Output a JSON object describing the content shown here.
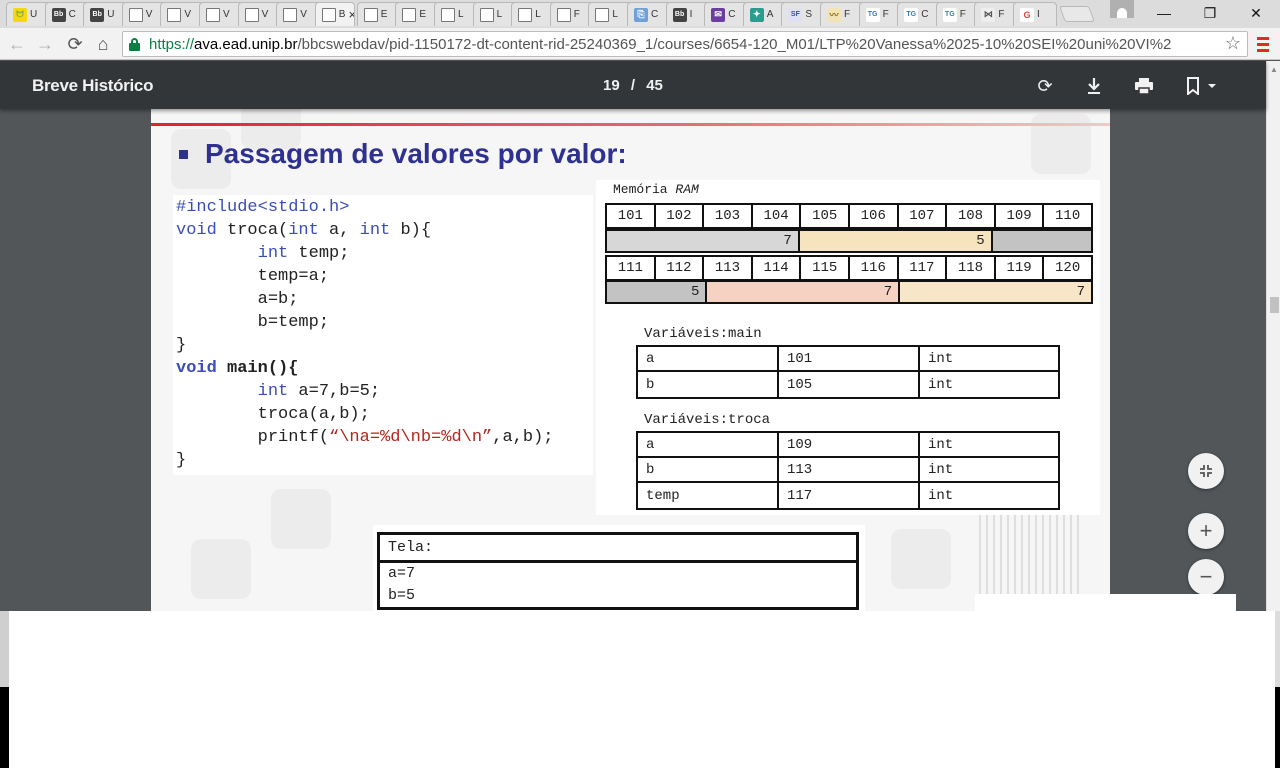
{
  "browser": {
    "tabs": [
      {
        "icon": "moodle-icon",
        "label": "U",
        "active": false
      },
      {
        "icon": "blackboard-icon",
        "label": "C",
        "active": false
      },
      {
        "icon": "blackboard-icon",
        "label": "U",
        "active": false
      },
      {
        "icon": "document-icon",
        "label": "V",
        "active": false
      },
      {
        "icon": "document-icon",
        "label": "V",
        "active": false
      },
      {
        "icon": "document-icon",
        "label": "V",
        "active": false
      },
      {
        "icon": "document-icon",
        "label": "V",
        "active": false
      },
      {
        "icon": "document-icon",
        "label": "V",
        "active": false
      },
      {
        "icon": "document-icon",
        "label": "B",
        "active": true
      },
      {
        "icon": "document-icon",
        "label": "E",
        "active": false
      },
      {
        "icon": "document-icon",
        "label": "E",
        "active": false
      },
      {
        "icon": "document-icon",
        "label": "L",
        "active": false
      },
      {
        "icon": "document-icon",
        "label": "L",
        "active": false
      },
      {
        "icon": "document-icon",
        "label": "L",
        "active": false
      },
      {
        "icon": "document-icon",
        "label": "F",
        "active": false
      },
      {
        "icon": "document-icon",
        "label": "L",
        "active": false
      },
      {
        "icon": "link-icon",
        "label": "C",
        "active": false
      },
      {
        "icon": "blackboard-icon",
        "label": "I",
        "active": false
      },
      {
        "icon": "mail-icon",
        "label": "C",
        "active": false
      },
      {
        "icon": "app-icon",
        "label": "A",
        "active": false
      },
      {
        "icon": "sf-icon",
        "label": "S",
        "active": false
      },
      {
        "icon": "fingerprint-icon",
        "label": "F",
        "active": false
      },
      {
        "icon": "tg-icon",
        "label": "F",
        "active": false
      },
      {
        "icon": "tg-icon",
        "label": "C",
        "active": false
      },
      {
        "icon": "tg-icon",
        "label": "F",
        "active": false
      },
      {
        "icon": "network-icon",
        "label": "F",
        "active": false
      },
      {
        "icon": "google-icon",
        "label": "I",
        "active": false
      }
    ],
    "active_tab_close": "×",
    "url": {
      "scheme": "https://",
      "host": "ava.ead.unip.br",
      "path": "/bbcswebdav/pid-1150172-dt-content-rid-25240369_1/courses/6654-120_M01/LTP%20Vanessa%2025-10%20SEI%20uni%20VI%2"
    }
  },
  "pdf": {
    "title": "Breve Histórico",
    "page_current": "19",
    "page_total": "45",
    "page_sep": "/"
  },
  "slide": {
    "heading": "Passagem de valores por valor:",
    "code_lines": [
      [
        {
          "t": "#include<stdio.h>",
          "c": "kw"
        }
      ],
      [
        {
          "t": "void",
          "c": "kw"
        },
        {
          "t": " troca(",
          "c": ""
        },
        {
          "t": "int",
          "c": "kw"
        },
        {
          "t": " a, ",
          "c": ""
        },
        {
          "t": "int",
          "c": "kw"
        },
        {
          "t": " b){",
          "c": ""
        }
      ],
      [
        {
          "t": "        ",
          "c": ""
        },
        {
          "t": "int",
          "c": "kw"
        },
        {
          "t": " temp;",
          "c": ""
        }
      ],
      [
        {
          "t": "        temp=a;",
          "c": ""
        }
      ],
      [
        {
          "t": "        a=b;",
          "c": ""
        }
      ],
      [
        {
          "t": "        b=temp;",
          "c": ""
        }
      ],
      [
        {
          "t": "}",
          "c": ""
        }
      ],
      [
        {
          "t": "void",
          "c": "kw bold"
        },
        {
          "t": " main(){",
          "c": "bold"
        }
      ],
      [
        {
          "t": "        ",
          "c": ""
        },
        {
          "t": "int",
          "c": "kw"
        },
        {
          "t": " a=7,b=5;",
          "c": ""
        }
      ],
      [
        {
          "t": "        troca(a,b);",
          "c": ""
        }
      ],
      [
        {
          "t": "        printf(",
          "c": ""
        },
        {
          "t": "“\\na=%d\\nb=%d\\n”",
          "c": "str"
        },
        {
          "t": ",a,b);",
          "c": ""
        }
      ],
      [
        {
          "t": "}",
          "c": ""
        }
      ]
    ],
    "ram": {
      "title_prefix": "Memória ",
      "title_em": "RAM",
      "row1_addresses": [
        "101",
        "102",
        "103",
        "104",
        "105",
        "106",
        "107",
        "108",
        "109",
        "110"
      ],
      "row1_values": [
        {
          "value": "7",
          "span": 4,
          "color": "#d7d7d7"
        },
        {
          "value": "5",
          "span": 4,
          "color": "#f6e4bf"
        },
        {
          "value": "",
          "span": 2,
          "color": "#c3c3c3"
        }
      ],
      "row2_addresses": [
        "111",
        "112",
        "113",
        "114",
        "115",
        "116",
        "117",
        "118",
        "119",
        "120"
      ],
      "row2_values": [
        {
          "value": "5",
          "span": 2,
          "color": "#c3c3c3"
        },
        {
          "value": "7",
          "span": 4,
          "color": "#f5d2c2"
        },
        {
          "value": "7",
          "span": 4,
          "color": "#f7e6c8"
        }
      ]
    },
    "vars_main": {
      "title": "Variáveis:main",
      "rows": [
        [
          "a",
          "101",
          "int"
        ],
        [
          "b",
          "105",
          "int"
        ]
      ]
    },
    "vars_troca": {
      "title": "Variáveis:troca",
      "rows": [
        [
          "a",
          "109",
          "int"
        ],
        [
          "b",
          "113",
          "int"
        ],
        [
          "temp",
          "117",
          "int"
        ]
      ]
    },
    "tela": {
      "title": "Tela:",
      "lines": [
        "a=7",
        "b=5"
      ]
    }
  }
}
